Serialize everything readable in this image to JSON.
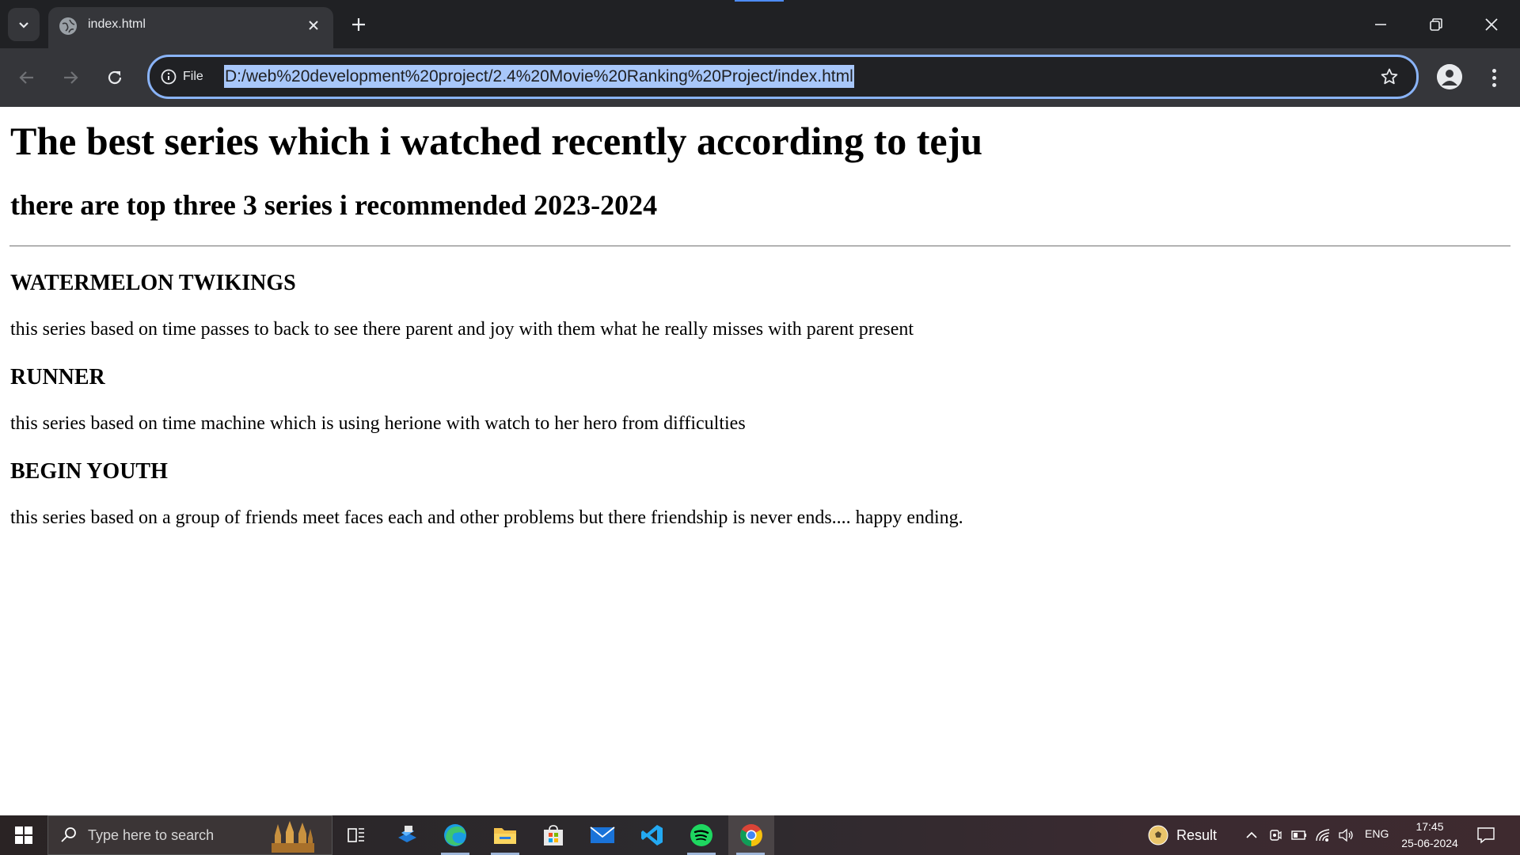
{
  "browser": {
    "tab_title": "index.html",
    "site_info_label": "File",
    "url": "D:/web%20development%20project/2.4%20Movie%20Ranking%20Project/index.html"
  },
  "page": {
    "heading": "The best series which i watched recently according to teju",
    "subheading": "there are top three 3 series i recommended 2023-2024",
    "series": [
      {
        "title": "WATERMELON TWIKINGS",
        "description": "this series based on time passes to back to see there parent and joy with them what he really misses with parent present"
      },
      {
        "title": "RUNNER",
        "description": "this series based on time machine which is using herione with watch to her hero from difficulties"
      },
      {
        "title": "BEGIN YOUTH",
        "description": "this series based on a group of friends meet faces each and other problems but there friendship is never ends.... happy ending."
      }
    ]
  },
  "taskbar": {
    "search_placeholder": "Type here to search",
    "weather_label": "Result",
    "language": "ENG",
    "time": "17:45",
    "date": "25-06-2024",
    "apps": [
      "task-view",
      "file-share",
      "edge",
      "file-explorer",
      "microsoft-store",
      "mail",
      "vs-code",
      "spotify",
      "chrome"
    ]
  }
}
